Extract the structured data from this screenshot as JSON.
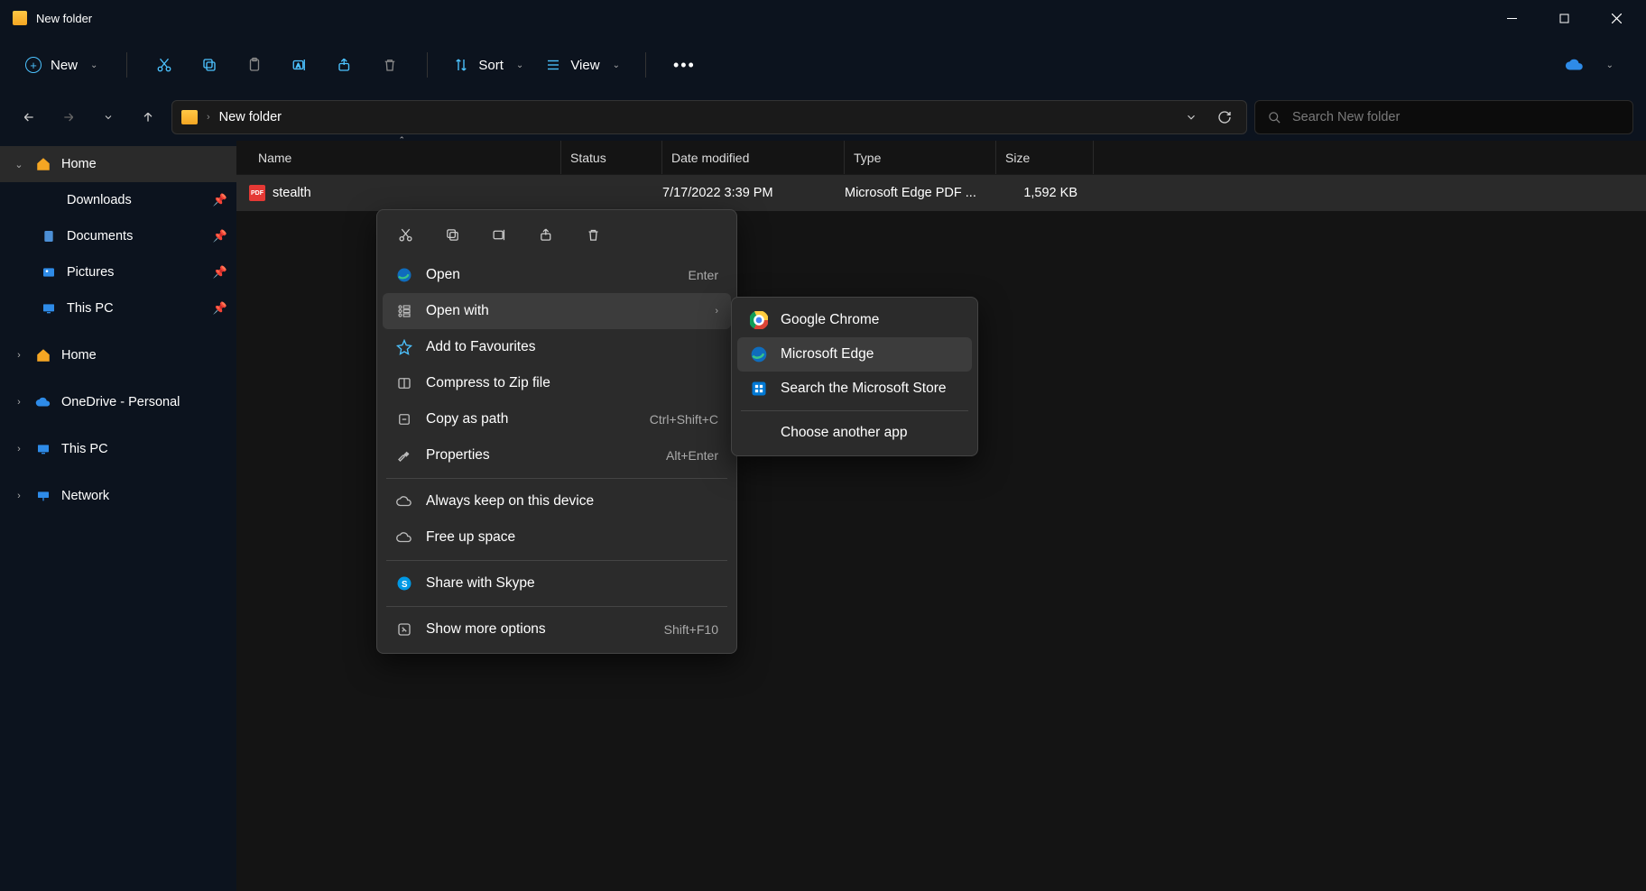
{
  "window": {
    "title": "New folder"
  },
  "toolbar": {
    "new": "New",
    "sort": "Sort",
    "view": "View"
  },
  "address": {
    "crumb": "New folder"
  },
  "search": {
    "placeholder": "Search New folder"
  },
  "sidebar": {
    "home1": "Home",
    "downloads": "Downloads",
    "documents": "Documents",
    "pictures": "Pictures",
    "thispc1": "This PC",
    "home2": "Home",
    "onedrive": "OneDrive - Personal",
    "thispc2": "This PC",
    "network": "Network"
  },
  "columns": {
    "name": "Name",
    "status": "Status",
    "date": "Date modified",
    "type": "Type",
    "size": "Size"
  },
  "files": [
    {
      "name": "stealth",
      "date": "7/17/2022 3:39 PM",
      "type": "Microsoft Edge PDF ...",
      "size": "1,592 KB"
    }
  ],
  "context": {
    "open": "Open",
    "open_kb": "Enter",
    "openwith": "Open with",
    "fav": "Add to Favourites",
    "zip": "Compress to Zip file",
    "copypath": "Copy as path",
    "copypath_kb": "Ctrl+Shift+C",
    "props": "Properties",
    "props_kb": "Alt+Enter",
    "keep": "Always keep on this device",
    "freeup": "Free up space",
    "skype": "Share with Skype",
    "more": "Show more options",
    "more_kb": "Shift+F10"
  },
  "openwith": {
    "chrome": "Google Chrome",
    "edge": "Microsoft Edge",
    "store": "Search the Microsoft Store",
    "other": "Choose another app"
  }
}
